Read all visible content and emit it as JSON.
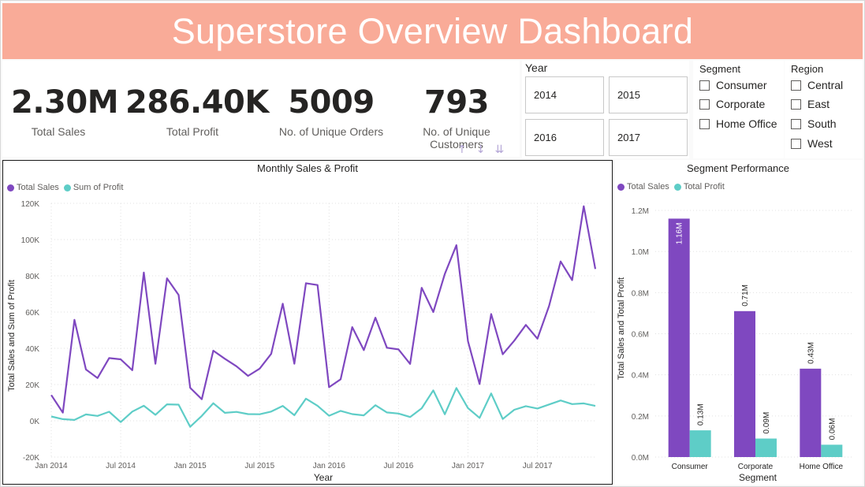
{
  "header": {
    "title": "Superstore Overview Dashboard"
  },
  "kpis": [
    {
      "value": "2.30M",
      "label": "Total Sales"
    },
    {
      "value": "286.40K",
      "label": "Total Profit"
    },
    {
      "value": "5009",
      "label": "No. of Unique Orders"
    },
    {
      "value": "793",
      "label": "No. of Unique Customers"
    }
  ],
  "year_slicer": {
    "title": "Year",
    "options": [
      "2014",
      "2015",
      "2016",
      "2017"
    ]
  },
  "segment_slicer": {
    "title": "Segment",
    "options": [
      "Consumer",
      "Corporate",
      "Home Office"
    ]
  },
  "region_slicer": {
    "title": "Region",
    "options": [
      "Central",
      "East",
      "South",
      "West"
    ]
  },
  "sort_icons": [
    "arrow-up-icon",
    "arrow-down-icon",
    "double-arrow-down-icon"
  ],
  "colors": {
    "banner": "#f9ab98",
    "sales": "#7f48c0",
    "profit": "#5ecdc7"
  },
  "chart_data": [
    {
      "type": "line",
      "title": "Monthly Sales & Profit",
      "xlabel": "Year",
      "ylabel": "Total Sales and Sum of Profit",
      "ylim": [
        -20000,
        120000
      ],
      "yticks": [
        -20000,
        0,
        20000,
        40000,
        60000,
        80000,
        100000,
        120000
      ],
      "ytick_labels": [
        "-20K",
        "0K",
        "20K",
        "40K",
        "60K",
        "80K",
        "100K",
        "120K"
      ],
      "xtick_labels": [
        "Jan 2014",
        "Jul 2014",
        "Jan 2015",
        "Jul 2015",
        "Jan 2016",
        "Jul 2016",
        "Jan 2017",
        "Jul 2017"
      ],
      "xtick_index": [
        0,
        6,
        12,
        18,
        24,
        30,
        36,
        42
      ],
      "grid": true,
      "legend_position": "top-left",
      "series": [
        {
          "name": "Total Sales",
          "color": "#7f48c0",
          "values": [
            14200,
            4500,
            55700,
            28300,
            23600,
            34600,
            33900,
            27900,
            81800,
            31500,
            78600,
            69500,
            18200,
            11900,
            38700,
            34200,
            30100,
            24800,
            28800,
            36900,
            64600,
            31500,
            75900,
            74900,
            18500,
            22900,
            51700,
            39000,
            56900,
            40300,
            39400,
            31400,
            73400,
            60000,
            81000,
            96900,
            43900,
            20300,
            58900,
            36700,
            44200,
            52900,
            45300,
            63300,
            87900,
            77600,
            118400,
            83800
          ]
        },
        {
          "name": "Sum of Profit",
          "color": "#5ecdc7",
          "values": [
            2400,
            900,
            500,
            3500,
            2700,
            5000,
            -700,
            5100,
            8300,
            3300,
            9100,
            8900,
            -3300,
            2700,
            9700,
            4400,
            4900,
            3700,
            3600,
            5100,
            8200,
            3100,
            12200,
            8300,
            2800,
            5500,
            3700,
            3000,
            8600,
            4600,
            4000,
            2100,
            6900,
            16800,
            3600,
            18100,
            7000,
            1600,
            15100,
            1000,
            6100,
            8100,
            6800,
            9000,
            11200,
            9200,
            9600,
            8200
          ]
        }
      ]
    },
    {
      "type": "bar",
      "title": "Segment Performance",
      "xlabel": "Segment",
      "ylabel": "Total Sales and Total Profit",
      "ylim": [
        0,
        1200000
      ],
      "yticks": [
        0,
        200000,
        400000,
        600000,
        800000,
        1000000,
        1200000
      ],
      "ytick_labels": [
        "0.0M",
        "0.2M",
        "0.4M",
        "0.6M",
        "0.8M",
        "1.0M",
        "1.2M"
      ],
      "categories": [
        "Consumer",
        "Corporate",
        "Home Office"
      ],
      "legend_position": "top-left",
      "series": [
        {
          "name": "Total Sales",
          "color": "#7f48c0",
          "values": [
            1160000,
            710000,
            430000
          ],
          "labels": [
            "1.16M",
            "0.71M",
            "0.43M"
          ]
        },
        {
          "name": "Total Profit",
          "color": "#5ecdc7",
          "values": [
            130000,
            90000,
            60000
          ],
          "labels": [
            "0.13M",
            "0.09M",
            "0.06M"
          ]
        }
      ]
    }
  ]
}
